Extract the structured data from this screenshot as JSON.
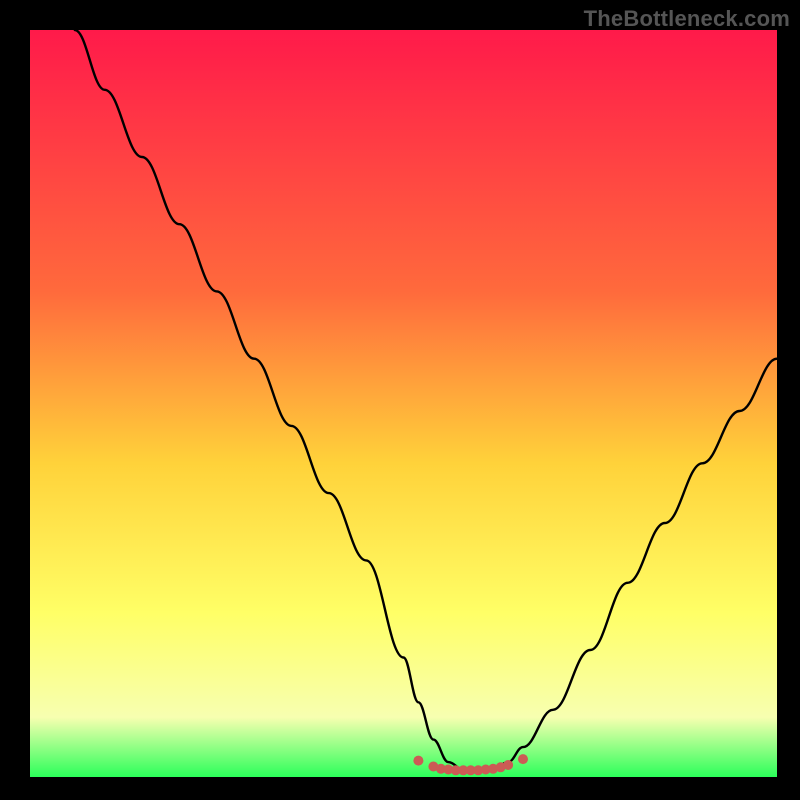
{
  "watermark": "TheBottleneck.com",
  "colors": {
    "bg": "#000000",
    "curve": "#000000",
    "marker": "#cc5b55",
    "grad_top": "#ff1a4a",
    "grad_mid1": "#ff6a3c",
    "grad_mid2": "#ffd23a",
    "grad_mid3": "#ffff66",
    "grad_mid4": "#f7ffb0",
    "grad_bottom": "#2bff5a"
  },
  "chart_data": {
    "type": "line",
    "title": "",
    "xlabel": "",
    "ylabel": "",
    "xlim": [
      0,
      100
    ],
    "ylim": [
      0,
      100
    ],
    "grid": false,
    "legend": false,
    "annotations": [],
    "series": [
      {
        "name": "bottleneck-curve",
        "x": [
          6,
          10,
          15,
          20,
          25,
          30,
          35,
          40,
          45,
          50,
          52,
          54,
          56,
          58,
          60,
          62,
          64,
          66,
          70,
          75,
          80,
          85,
          90,
          95,
          100
        ],
        "y": [
          100,
          92,
          83,
          74,
          65,
          56,
          47,
          38,
          29,
          16,
          10,
          5,
          2,
          1,
          1,
          1,
          2,
          4,
          9,
          17,
          26,
          34,
          42,
          49,
          56
        ]
      },
      {
        "name": "optimal-range-markers",
        "x": [
          52,
          54,
          55,
          56,
          57,
          58,
          59,
          60,
          61,
          62,
          63,
          64,
          66
        ],
        "y": [
          2.2,
          1.4,
          1.1,
          1.0,
          0.9,
          0.9,
          0.9,
          0.9,
          1.0,
          1.1,
          1.3,
          1.6,
          2.4
        ]
      }
    ]
  }
}
